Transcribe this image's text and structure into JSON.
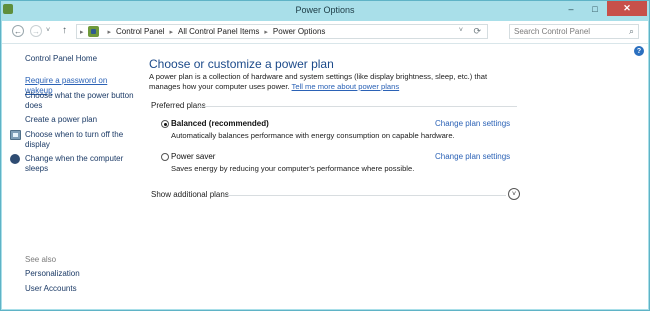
{
  "window": {
    "title": "Power Options",
    "controls": {
      "minimize": "–",
      "maximize": "□",
      "close": "✕"
    }
  },
  "nav": {
    "back": "←",
    "forward": "→",
    "recent": "˅",
    "up": "↑",
    "breadcrumbs": [
      "Control Panel",
      "All Control Panel Items",
      "Power Options"
    ],
    "crumb_separator": "▸",
    "address_dropdown": "˅",
    "refresh": "⟳",
    "search_placeholder": "Search Control Panel",
    "search_glyph": "⌕"
  },
  "help": "?",
  "sidebar": {
    "home": "Control Panel Home",
    "tasks": [
      "Require a password on wakeup",
      "Choose what the power button does",
      "Create a power plan",
      "Choose when to turn off the display",
      "Change when the computer sleeps"
    ],
    "see_also_header": "See also",
    "see_also": [
      "Personalization",
      "User Accounts"
    ]
  },
  "main": {
    "title": "Choose or customize a power plan",
    "description": "A power plan is a collection of hardware and system settings (like display brightness, sleep, etc.) that manages how your computer uses power.",
    "description_link": "Tell me more about power plans",
    "preferred_header": "Preferred plans",
    "plans": [
      {
        "name": "Balanced (recommended)",
        "description": "Automatically balances performance with energy consumption on capable hardware.",
        "link": "Change plan settings",
        "selected": true
      },
      {
        "name": "Power saver",
        "description": "Saves energy by reducing your computer's performance where possible.",
        "link": "Change plan settings",
        "selected": false
      }
    ],
    "show_additional": "Show additional plans",
    "expand_glyph": "˅"
  },
  "colors": {
    "accent": "#1c4a8a",
    "link": "#2b62b6",
    "close_button": "#c7504a",
    "chrome": "#a9dfe9"
  }
}
